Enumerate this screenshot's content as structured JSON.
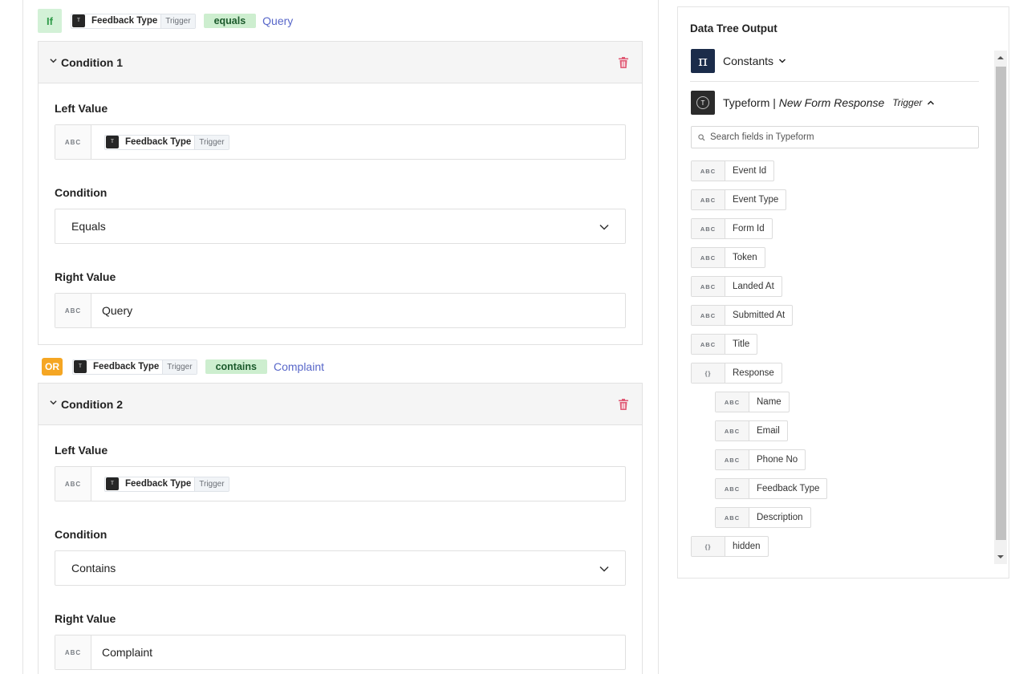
{
  "rules": [
    {
      "prefix": "If",
      "variable": "Feedback Type",
      "source_tag": "Trigger",
      "operator": "equals",
      "value": "Query"
    },
    {
      "prefix": "OR",
      "variable": "Feedback Type",
      "source_tag": "Trigger",
      "operator": "contains",
      "value": "Complaint"
    }
  ],
  "conditions": [
    {
      "title": "Condition 1",
      "left_label": "Left Value",
      "left_type": "ABC",
      "left_variable": "Feedback Type",
      "left_tag": "Trigger",
      "condition_label": "Condition",
      "condition_value": "Equals",
      "right_label": "Right Value",
      "right_type": "ABC",
      "right_value": "Query"
    },
    {
      "title": "Condition 2",
      "left_label": "Left Value",
      "left_type": "ABC",
      "left_variable": "Feedback Type",
      "left_tag": "Trigger",
      "condition_label": "Condition",
      "condition_value": "Contains",
      "right_label": "Right Value",
      "right_type": "ABC",
      "right_value": "Complaint"
    }
  ],
  "panel": {
    "title": "Data Tree Output",
    "constants_label": "Constants",
    "source_app": "Typeform | ",
    "source_event": "New Form Response",
    "source_tag": "Trigger",
    "search_placeholder": "Search fields in Typeform",
    "fields": [
      {
        "type": "ABC",
        "label": "Event Id"
      },
      {
        "type": "ABC",
        "label": "Event Type"
      },
      {
        "type": "ABC",
        "label": "Form Id"
      },
      {
        "type": "ABC",
        "label": "Token"
      },
      {
        "type": "ABC",
        "label": "Landed At"
      },
      {
        "type": "ABC",
        "label": "Submitted At"
      },
      {
        "type": "ABC",
        "label": "Title"
      },
      {
        "type": "{}",
        "label": "Response"
      },
      {
        "type": "ABC",
        "label": "Name"
      },
      {
        "type": "ABC",
        "label": "Email"
      },
      {
        "type": "ABC",
        "label": "Phone No"
      },
      {
        "type": "ABC",
        "label": "Feedback Type"
      },
      {
        "type": "ABC",
        "label": "Description"
      },
      {
        "type": "{}",
        "label": "hidden"
      }
    ]
  },
  "icons": {
    "typeform_logo_letter": "T",
    "constants_logo_glyph": "π"
  },
  "colors": {
    "if_badge_bg": "#d3f1d7",
    "or_badge_bg": "#f5a623",
    "operator_pill_bg": "#cdeecf",
    "value_link": "#5867c9",
    "trash": "#e05a75",
    "constants_logo_bg": "#1b2c4a"
  }
}
